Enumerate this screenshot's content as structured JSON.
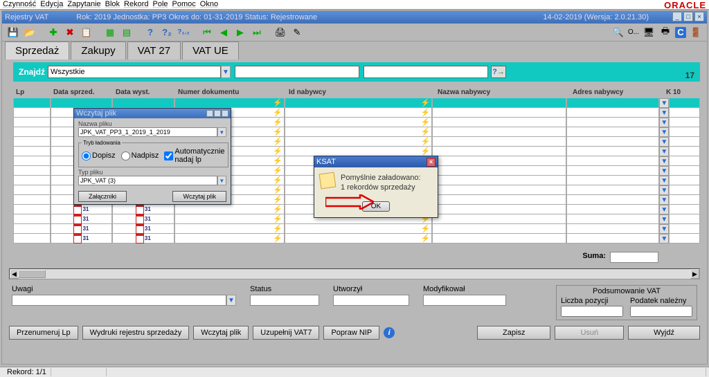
{
  "menu": [
    "Czynność",
    "Edycja",
    "Zapytanie",
    "Blok",
    "Rekord",
    "Pole",
    "Pomoc",
    "Okno"
  ],
  "oracle": "ORACLE",
  "titlebar": {
    "app": "Rejestry VAT",
    "context": "Rok: 2019 Jednostka: PP3 Okres do: 01-31-2019 Status: Rejestrowane",
    "date_ver": "14-02-2019  (Wersja: 2.0.21.30)"
  },
  "tabs": {
    "t1": "Sprzedaż",
    "t2": "Zakupy",
    "t3": "VAT 27",
    "t4": "VAT UE"
  },
  "filter": {
    "label": "Znajdź",
    "value": "Wszystkie",
    "count": "17"
  },
  "grid": {
    "headers": {
      "lp": "Lp",
      "ds": "Data sprzed.",
      "dw": "Data wyst.",
      "nd": "Numer dokumentu",
      "id": "Id nabywcy",
      "nn": "Nazwa nabywcy",
      "an": "Adres nabywcy",
      "k": "K 10"
    },
    "cal_day": "31"
  },
  "suma_label": "Suma:",
  "lower": {
    "uwagi": "Uwagi",
    "status": "Status",
    "utworzyl": "Utworzył",
    "modyfikowal": "Modyfikował",
    "pods_title": "Podsumowanie VAT",
    "liczba": "Liczba pozycji",
    "podnal": "Podatek należny"
  },
  "buttons": {
    "przenum": "Przenumeruj Lp",
    "wydruki": "Wydruki rejestru sprzedaży",
    "wczytaj": "Wczytaj plik",
    "uzup": "Uzupełnij VAT7",
    "popraw": "Popraw NIP",
    "zapisz": "Zapisz",
    "usun": "Usuń",
    "wyjdz": "Wyjdź"
  },
  "statusbar": {
    "rekord": "Rekord: 1/1"
  },
  "dlg_file": {
    "title": "Wczytaj plik",
    "nazwa_label": "Nazwa pliku",
    "nazwa_value": "JPK_VAT_PP3_1_2019_1_2019",
    "tryb_legend": "Tryb ładowania",
    "dopisz": "Dopisz",
    "nadpisz": "Nadpisz",
    "auto": "Automatycznie nadaj lp",
    "typ_label": "Typ pliku",
    "typ_value": "JPK_VAT (3)",
    "zalaczniki": "Załączniki",
    "wczytaj": "Wczytaj plik"
  },
  "dlg_msg": {
    "title": "KSAT",
    "line1": "Pomyślnie załadowano:",
    "line2": "1 rekordów sprzedaży",
    "ok": "OK"
  },
  "toolbar_o": "O...",
  "win_ctrl": {
    "min": "_",
    "max": "□",
    "close": "×"
  }
}
